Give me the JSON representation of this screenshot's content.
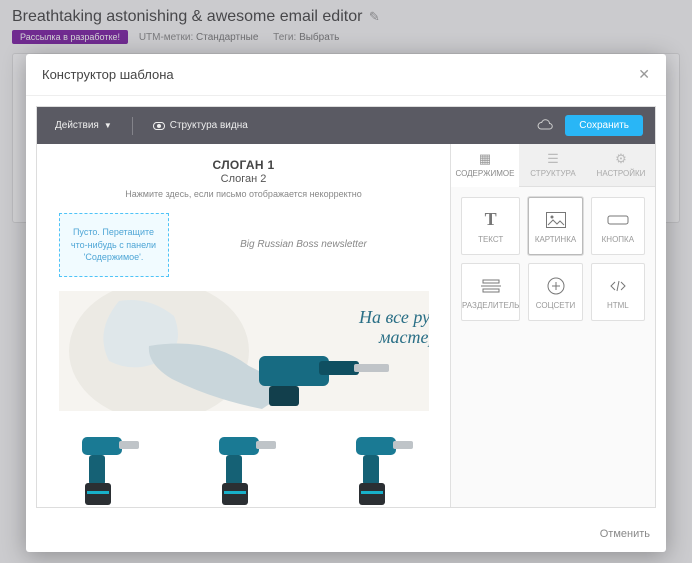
{
  "page": {
    "title": "Breathtaking astonishing & awesome email editor",
    "badge": "Рассылка в разработке!",
    "utm_label": "UTM-метки:",
    "utm_value": "Стандартные",
    "tags_label": "Теги:",
    "tags_value": "Выбрать"
  },
  "modal": {
    "title": "Конструктор шаблона",
    "cancel": "Отменить"
  },
  "toolbar": {
    "actions": "Действия",
    "structure": "Структура видна",
    "save": "Сохранить"
  },
  "canvas": {
    "slogan1": "СЛОГАН 1",
    "slogan2": "Слоган 2",
    "subtext": "Нажмите здесь, если письмо отображается некорректно",
    "dropzone": "Пусто. Перетащите что-нибудь с панели 'Содержимое'.",
    "newsletter": "Big Russian Boss newsletter",
    "hero_headline1": "На все руки",
    "hero_headline2": "мастер!"
  },
  "sidebar": {
    "tabs": [
      {
        "label": "СОДЕРЖИМОЕ"
      },
      {
        "label": "СТРУКТУРА"
      },
      {
        "label": "НАСТРОЙКИ"
      }
    ],
    "blocks": [
      {
        "label": "ТЕКСТ"
      },
      {
        "label": "КАРТИНКА"
      },
      {
        "label": "КНОПКА"
      },
      {
        "label": "РАЗДЕЛИТЕЛЬ"
      },
      {
        "label": "СОЦСЕТИ"
      },
      {
        "label": "HTML"
      }
    ]
  }
}
